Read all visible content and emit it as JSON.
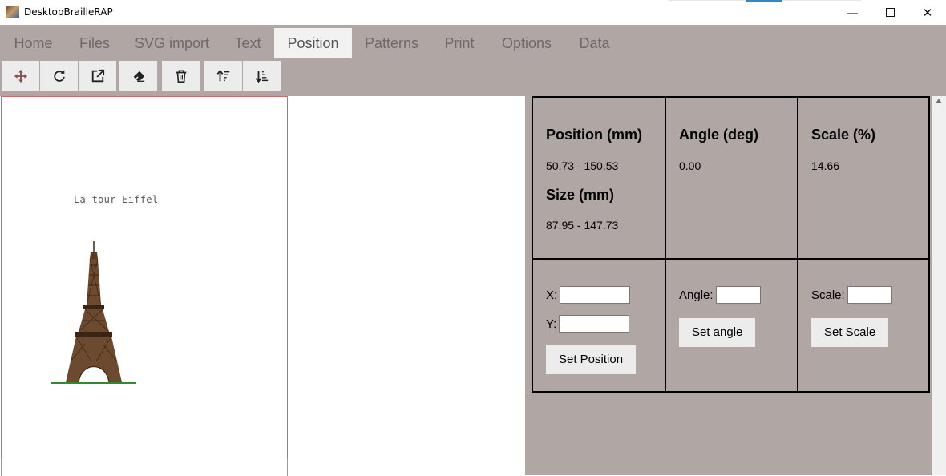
{
  "window": {
    "title": "DesktopBrailleRAP",
    "controls": {
      "minimize": "—",
      "close": "✕"
    }
  },
  "menu": {
    "tabs": [
      {
        "label": "Home"
      },
      {
        "label": "Files"
      },
      {
        "label": "SVG import"
      },
      {
        "label": "Text"
      },
      {
        "label": "Position"
      },
      {
        "label": "Patterns"
      },
      {
        "label": "Print"
      },
      {
        "label": "Options"
      },
      {
        "label": "Data"
      }
    ],
    "active": "Position"
  },
  "toolbar": {
    "icons": [
      "move-icon",
      "rotate-icon",
      "external-link-icon",
      "eraser-icon",
      "trash-icon",
      "sort-ascending-icon",
      "sort-descending-icon"
    ]
  },
  "document": {
    "text": "La tour Eiffel"
  },
  "properties": {
    "position": {
      "label": "Position (mm)",
      "value": "50.73 - 150.53"
    },
    "size": {
      "label": "Size (mm)",
      "value": "87.95 - 147.73"
    },
    "angle": {
      "label": "Angle (deg)",
      "value": "0.00"
    },
    "scale": {
      "label": "Scale (%)",
      "value": "14.66"
    }
  },
  "form": {
    "x_label": "X:",
    "y_label": "Y:",
    "set_position": "Set Position",
    "angle_label": "Angle:",
    "set_angle": "Set angle",
    "scale_label": "Scale:",
    "set_scale": "Set Scale"
  },
  "colors": {
    "panel_bg": "#b0a6a4",
    "page_border": "#d06a6a",
    "ground": "#2e8b2e",
    "tower": "#5a3a24"
  }
}
